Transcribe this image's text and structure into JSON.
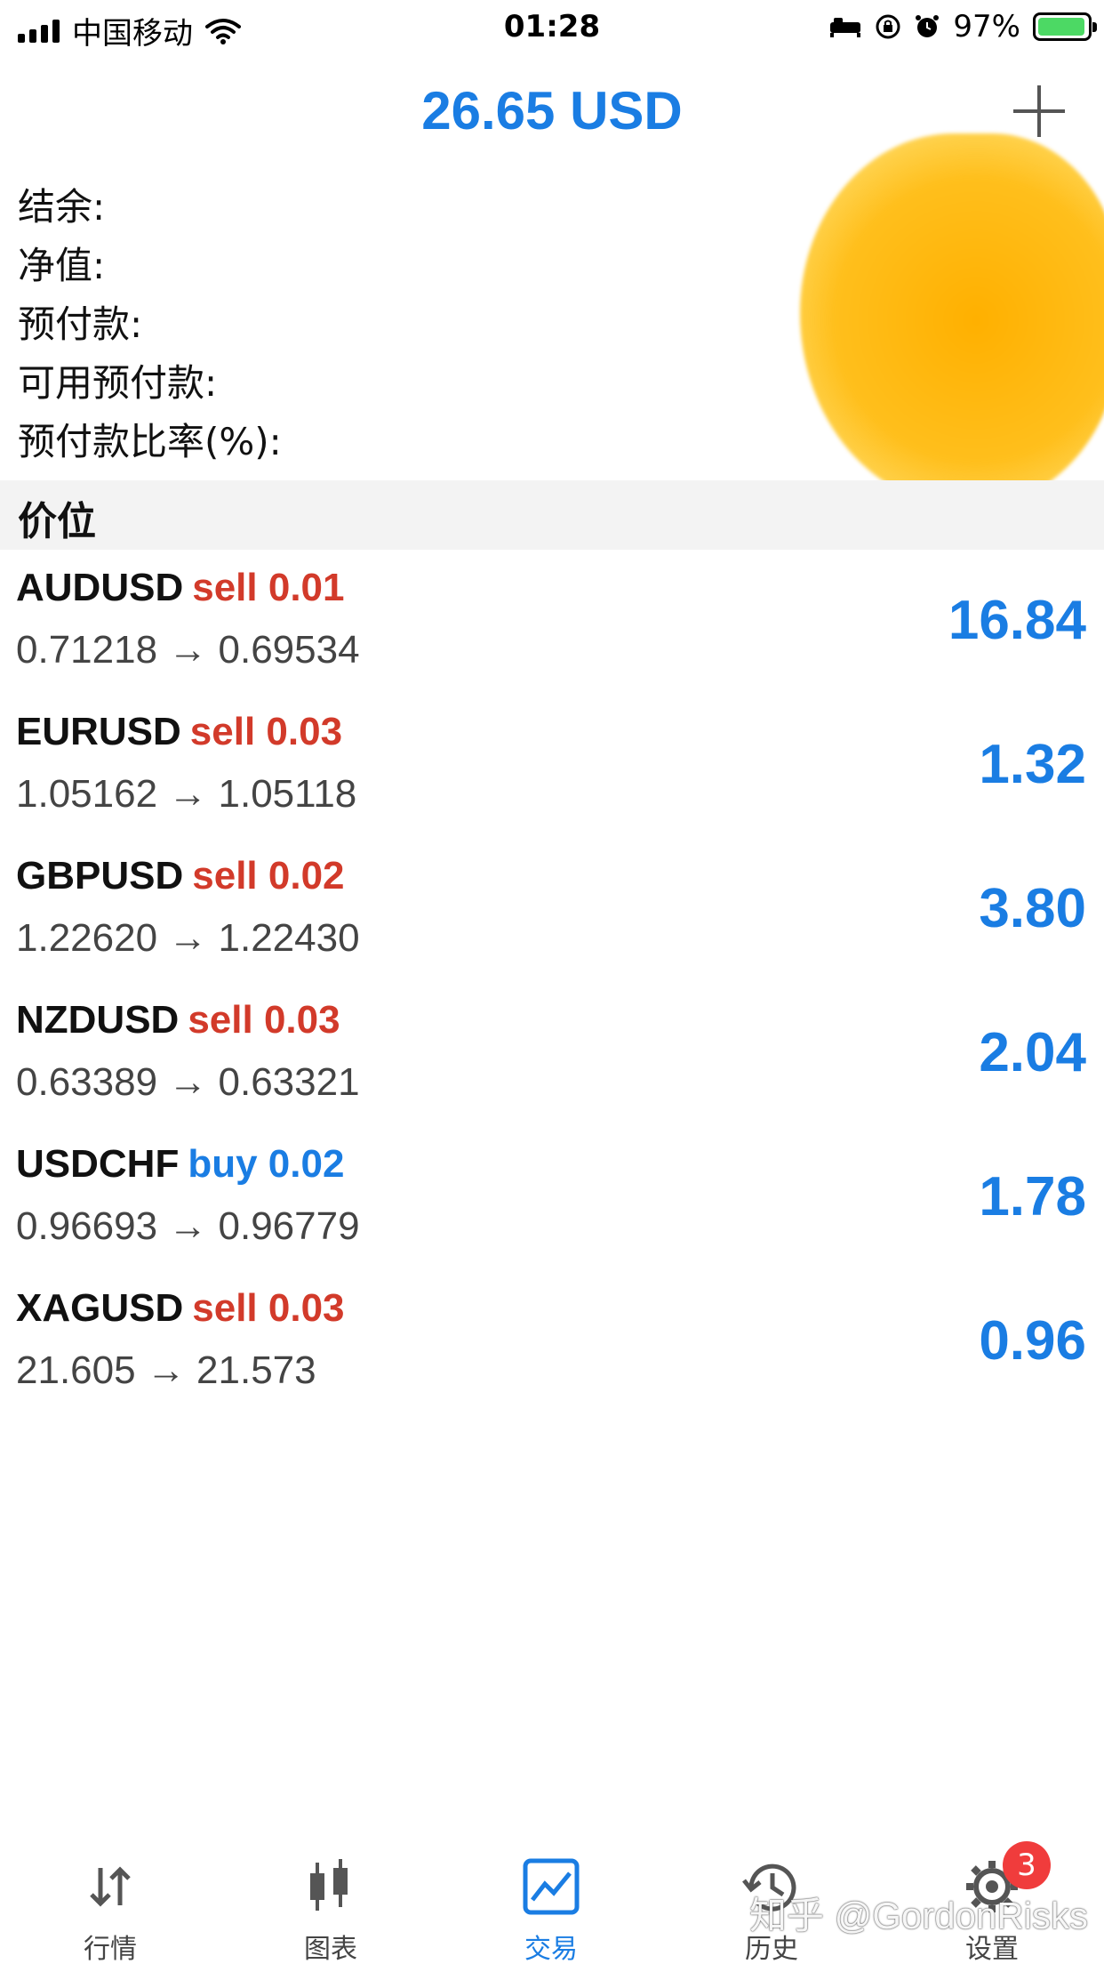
{
  "status_bar": {
    "carrier": "中国移动",
    "time": "01:28",
    "battery_percent": "97%",
    "battery_level": 0.97,
    "icons": [
      "signal-icon",
      "wifi-icon",
      "bed-icon",
      "rotation-lock-icon",
      "alarm-icon",
      "battery-charging-icon"
    ]
  },
  "header": {
    "balance": "26.65 USD",
    "add_icon": "plus-icon"
  },
  "summary": {
    "labels": [
      "结余:",
      "净值:",
      "预付款:",
      "可用预付款:",
      "预付款比率(%):"
    ]
  },
  "section": {
    "title": "价位"
  },
  "positions": [
    {
      "symbol": "AUDUSD",
      "side": "sell",
      "volume": "0.01",
      "prices": "0.71218 → 0.69534",
      "profit": "16.84"
    },
    {
      "symbol": "EURUSD",
      "side": "sell",
      "volume": "0.03",
      "prices": "1.05162 → 1.05118",
      "profit": "1.32"
    },
    {
      "symbol": "GBPUSD",
      "side": "sell",
      "volume": "0.02",
      "prices": "1.22620 → 1.22430",
      "profit": "3.80"
    },
    {
      "symbol": "NZDUSD",
      "side": "sell",
      "volume": "0.03",
      "prices": "0.63389 → 0.63321",
      "profit": "2.04"
    },
    {
      "symbol": "USDCHF",
      "side": "buy",
      "volume": "0.02",
      "prices": "0.96693 → 0.96779",
      "profit": "1.78"
    },
    {
      "symbol": "XAGUSD",
      "side": "sell",
      "volume": "0.03",
      "prices": "21.605 → 21.573",
      "profit": "0.96"
    }
  ],
  "tabs": [
    {
      "label": "行情",
      "icon": "quotes-arrows-icon"
    },
    {
      "label": "图表",
      "icon": "chart-candles-icon"
    },
    {
      "label": "交易",
      "icon": "trade-icon"
    },
    {
      "label": "历史",
      "icon": "history-icon"
    },
    {
      "label": "设置",
      "icon": "gear-icon",
      "badge": "3"
    }
  ],
  "watermark": "知乎 @GordonRisks",
  "colors": {
    "accent": "#1a7de3",
    "sell": "#d23a2a",
    "badge": "#f03c3c"
  }
}
